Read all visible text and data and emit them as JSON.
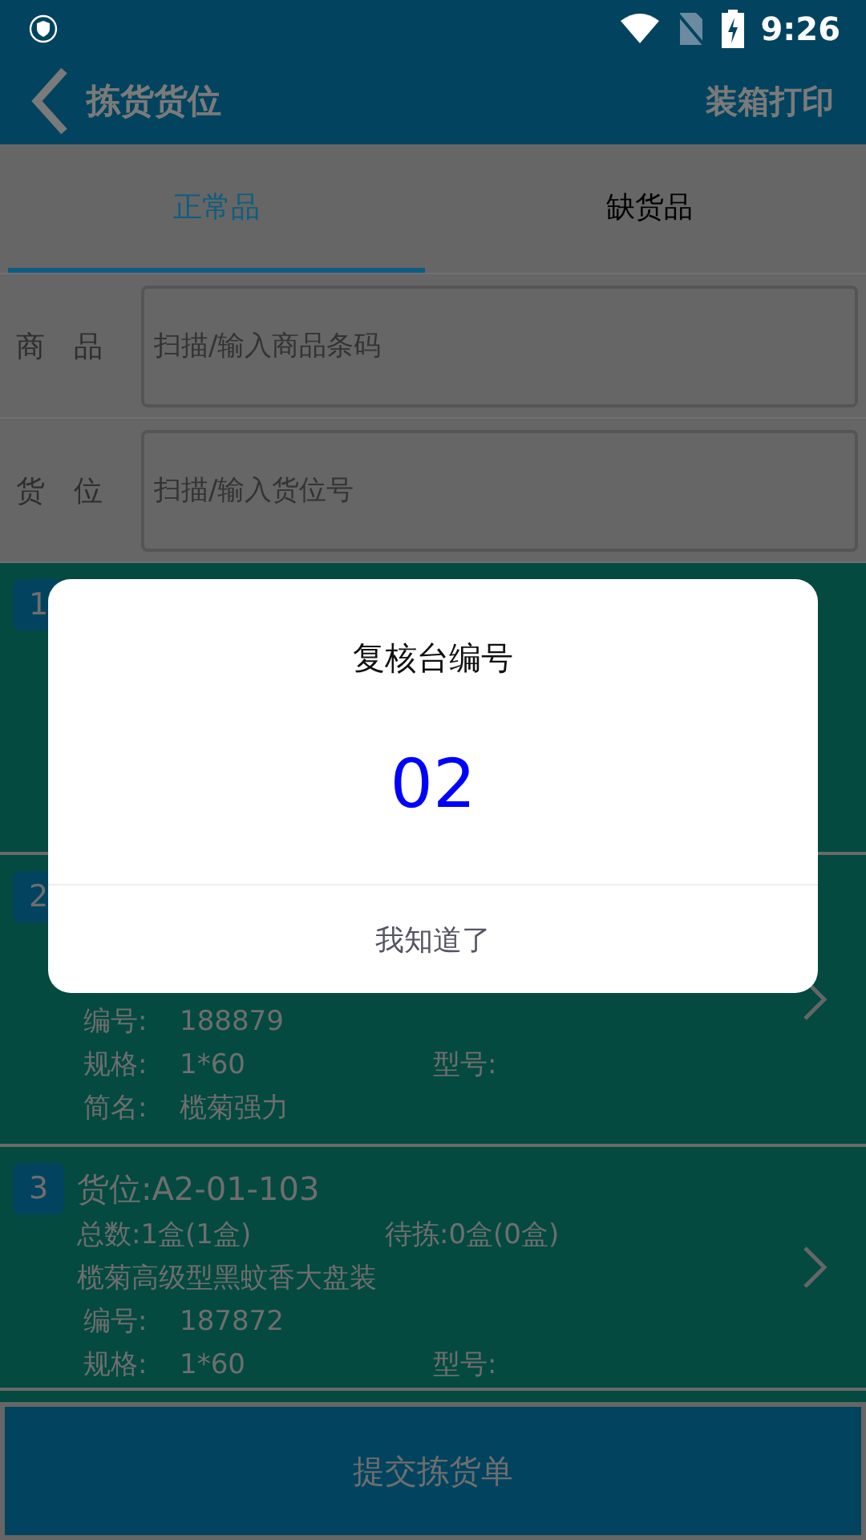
{
  "status_bar": {
    "time": "9:26"
  },
  "app_bar": {
    "title": "拣货货位",
    "action": "装箱打印"
  },
  "tabs": [
    {
      "label": "正常品",
      "selected": true
    },
    {
      "label": "缺货品",
      "selected": false
    }
  ],
  "fields": [
    {
      "label": "商　品",
      "placeholder": "扫描/输入商品条码"
    },
    {
      "label": "货　位",
      "placeholder": "扫描/输入货位号"
    }
  ],
  "items": [
    {
      "number": "1"
    },
    {
      "number": "2",
      "details": [
        {
          "label": "编号:",
          "value": "188879"
        },
        {
          "label": "规格:",
          "value": "1*60",
          "extra_label": "型号:"
        },
        {
          "label": "简名:",
          "value": "榄菊强力"
        }
      ]
    },
    {
      "number": "3",
      "location": "货位:A2-01-103",
      "counts": [
        "总数:1盒(1盒)",
        "待拣:0盒(0盒)"
      ],
      "name": "榄菊高级型黑蚊香大盘装",
      "details": [
        {
          "label": "编号:",
          "value": "187872"
        },
        {
          "label": "规格:",
          "value": "1*60",
          "extra_label": "型号:"
        }
      ]
    }
  ],
  "submit_button": "提交拣货单",
  "dialog": {
    "title": "复核台编号",
    "value": "02",
    "button": "我知道了"
  }
}
